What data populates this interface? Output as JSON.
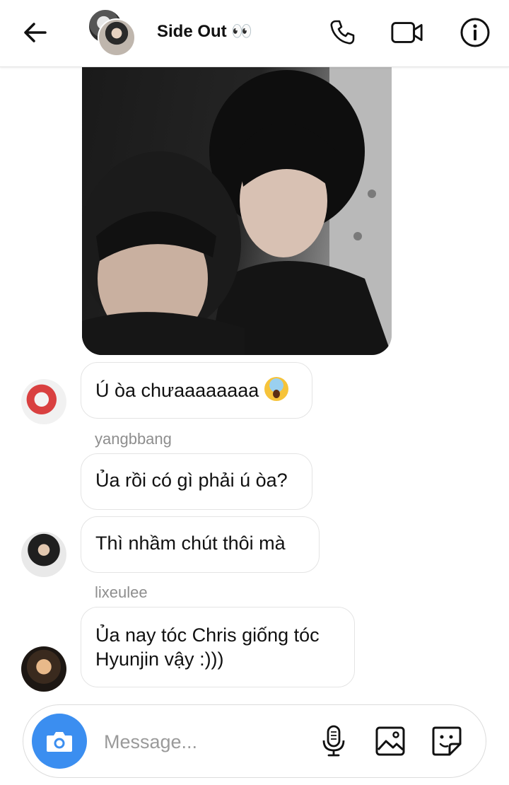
{
  "header": {
    "title": "Side Out 👀",
    "back_icon": "arrow-left-icon",
    "actions": [
      "phone-icon",
      "video-call-icon",
      "info-icon"
    ]
  },
  "messages": [
    {
      "sender": "",
      "text": "Ú òa chưaaaaaaaa",
      "emoji": "scream-emoji",
      "avatar": "avatar-yangbbang"
    },
    {
      "sender": "yangbbang",
      "text": "Ủa rồi có gì phải ú òa?",
      "avatar": ""
    },
    {
      "sender": "",
      "text": "Thì nhầm chút thôi mà",
      "avatar": "avatar-lixeulee"
    },
    {
      "sender": "lixeulee",
      "text": "Ủa nay tóc Chris giống tóc Hyunjin vậy :)))",
      "avatar": "avatar-chris"
    }
  ],
  "composer": {
    "placeholder": "Message...",
    "icons": [
      "camera-icon",
      "microphone-icon",
      "gallery-icon",
      "sticker-icon"
    ]
  },
  "colors": {
    "accent": "#3b8ef0",
    "bubble_border": "#e4e4e4",
    "sender_text": "#8e8e8e"
  }
}
